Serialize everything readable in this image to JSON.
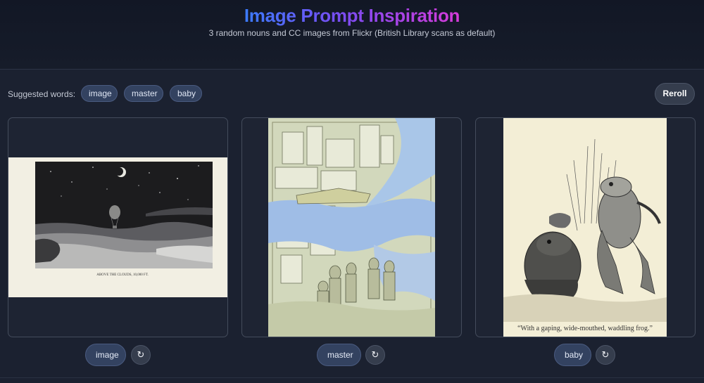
{
  "header": {
    "title": "Image Prompt Inspiration",
    "subtitle": "3 random nouns and CC images from Flickr (British Library scans as default)"
  },
  "toolbar": {
    "suggested_label": "Suggested words:",
    "words": [
      "image",
      "master",
      "baby"
    ],
    "reroll_label": "Reroll"
  },
  "cards": [
    {
      "word": "image",
      "caption": "ABOVE THE CLOUDS, 10,000 FT.",
      "refresh_icon": "refresh-icon"
    },
    {
      "word": "master",
      "refresh_icon": "refresh-icon"
    },
    {
      "word": "baby",
      "caption": "“With a gaping, wide-mouthed, waddling frog.”",
      "refresh_icon": "refresh-icon"
    }
  ],
  "refresh_glyph": "↻",
  "colors": {
    "title_gradient": [
      "#3b7bff",
      "#7a4cf2",
      "#d63bd9"
    ],
    "chip_bg": "#334260",
    "page_bg": "#1b2130"
  }
}
